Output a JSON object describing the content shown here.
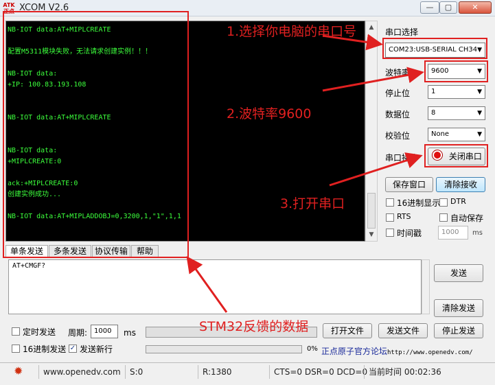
{
  "window": {
    "title": "XCOM V2.6",
    "logo_text": "ATK 正点",
    "minimize_glyph": "—",
    "maximize_glyph": "▢",
    "close_glyph": "✕"
  },
  "console": {
    "lines": [
      "NB-IOT data:AT+MIPLCREATE",
      "",
      "配置M5311模块失败，无法请求创建实例！！！",
      "",
      "NB-IOT data:",
      "+IP: 100.83.193.108",
      "",
      "",
      "NB-IOT data:AT+MIPLCREATE",
      "",
      "",
      "NB-IOT data:",
      "+MIPLCREATE:0",
      "",
      "ack:+MIPLCREATE:0",
      "创建实例成功...",
      "",
      "NB-IOT data:AT+MIPLADDOBJ=0,3200,1,\"1\",1,1"
    ],
    "scroll_up_glyph": "▲",
    "scroll_down_glyph": "▼"
  },
  "settings": {
    "port_label": "串口选择",
    "port_value": "COM23:USB-SERIAL CH34",
    "baud_label": "波特率",
    "baud_value": "9600",
    "stopbits_label": "停止位",
    "stopbits_value": "1",
    "databits_label": "数据位",
    "databits_value": "8",
    "parity_label": "校验位",
    "parity_value": "None",
    "operation_label": "串口操作",
    "close_port_button": "关闭串口",
    "dropdown_arrow": "▼"
  },
  "actions": {
    "save_window": "保存窗口",
    "clear_receive": "清除接收",
    "hex_display": "16进制显示",
    "dtr": "DTR",
    "rts": "RTS",
    "auto_save": "自动保存",
    "timestamp": "时间戳",
    "timestamp_value": "1000",
    "timestamp_unit": "ms"
  },
  "tabs": [
    "单条发送",
    "多条发送",
    "协议传输",
    "帮助"
  ],
  "send": {
    "text": "AT+CMGF?",
    "send_button": "发送",
    "clear_send_button": "清除发送",
    "timed_send": "定时发送",
    "period_label": "周期:",
    "period_value": "1000",
    "period_unit": "ms",
    "hex_send": "16进制发送",
    "send_newline": "发送新行",
    "send_newline_checked": "✓",
    "progress_value": "0%",
    "open_file": "打开文件",
    "send_file": "发送文件",
    "stop_send": "停止发送",
    "forum_text": "正点原子官方论坛",
    "forum_url": "http://www.openedv.com/"
  },
  "status": {
    "gear_glyph": "✹",
    "website": "www.openedv.com",
    "sent": "S:0",
    "received": "R:1380",
    "signals": "CTS=0 DSR=0 DCD=0",
    "time": "当前时间 00:02:36"
  },
  "annotations": {
    "step1": "1.选择你电脑的串口号",
    "step2": "2.波特率9600",
    "step3": "3.打开串口",
    "feedback": "STM32反馈的数据"
  },
  "colors": {
    "console_text": "#3cff3c",
    "console_bg": "#000000",
    "annotation_red": "#e02020"
  }
}
